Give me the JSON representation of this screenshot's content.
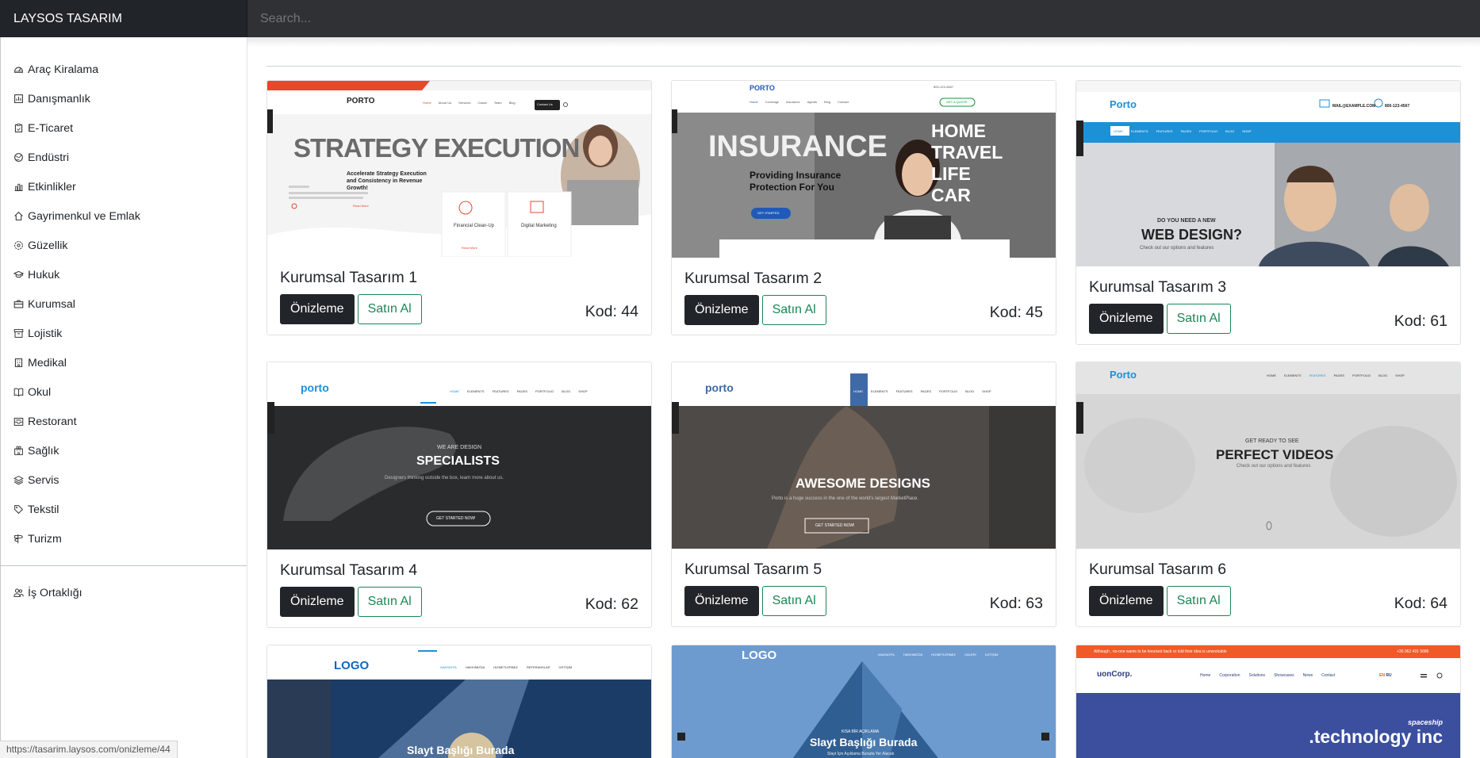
{
  "app": {
    "brand": "LAYSOS TASARIM"
  },
  "search": {
    "placeholder": "Search..."
  },
  "sidebar": {
    "items": [
      {
        "label": "Araç Kiralama",
        "icon": "speedometer-icon"
      },
      {
        "label": "Danışmanlık",
        "icon": "chart-icon"
      },
      {
        "label": "E-Ticaret",
        "icon": "clipboard-icon"
      },
      {
        "label": "Endüstri",
        "icon": "globe-icon"
      },
      {
        "label": "Etkinlikler",
        "icon": "bar-chart-icon"
      },
      {
        "label": "Gayrimenkul ve Emlak",
        "icon": "house-icon"
      },
      {
        "label": "Güzellik",
        "icon": "flower-icon"
      },
      {
        "label": "Hukuk",
        "icon": "mortarboard-icon"
      },
      {
        "label": "Kurumsal",
        "icon": "briefcase-icon"
      },
      {
        "label": "Lojistik",
        "icon": "archive-icon"
      },
      {
        "label": "Medikal",
        "icon": "building-icon"
      },
      {
        "label": "Okul",
        "icon": "book-icon"
      },
      {
        "label": "Restorant",
        "icon": "inbox-icon"
      },
      {
        "label": "Sağlık",
        "icon": "hospital-icon"
      },
      {
        "label": "Servis",
        "icon": "layers-icon"
      },
      {
        "label": "Tekstil",
        "icon": "tag-icon"
      },
      {
        "label": "Turizm",
        "icon": "signpost-icon"
      }
    ],
    "partner": {
      "label": "İş Ortaklığı",
      "icon": "people-icon"
    }
  },
  "cards": [
    {
      "title": "Kurumsal Tasarım 1",
      "kod": "Kod: 44",
      "preview": "Önizleme",
      "buy": "Satın Al",
      "thumb": {
        "brand": "PORTO",
        "nav": [
          "Home",
          "About Us",
          "Services",
          "Cases",
          "Team",
          "Blog"
        ],
        "cta": "Contact Us",
        "headline": "STRATEGY EXECUTION",
        "sub": "Accelerate Strategy Execution and Consistency in Revenue Growth!",
        "box1": "Financial Clean-Up",
        "box2": "Digital Marketing",
        "link": "Read More",
        "boxlink": "Read More"
      }
    },
    {
      "title": "Kurumsal Tasarım 2",
      "kod": "Kod: 45",
      "preview": "Önizleme",
      "buy": "Satın Al",
      "thumb": {
        "brand": "PORTO",
        "phone": "800-123-4567",
        "nav": [
          "Home",
          "Coverage",
          "Insurance",
          "Agents",
          "Blog",
          "Contact"
        ],
        "quote": "GET A QUOTE",
        "big": "INSURANCE",
        "words": [
          "HOME",
          "TRAVEL",
          "LIFE",
          "CAR"
        ],
        "sub1": "Providing Insurance",
        "sub2": "Protection For You",
        "btn": "GET STARTED"
      }
    },
    {
      "title": "Kurumsal Tasarım 3",
      "kod": "Kod: 61",
      "preview": "Önizleme",
      "buy": "Satın Al",
      "thumb": {
        "brand": "Porto",
        "email": "MAIL@EXAMPLE.COM",
        "phone": "800-123-4567",
        "nav": [
          "HOME",
          "ELEMENTS",
          "FEATURES",
          "PAGES",
          "PORTFOLIO",
          "BLOG",
          "SHOP"
        ],
        "pre": "DO YOU NEED A NEW",
        "headline": "WEB DESIGN?",
        "sub": "Check out our options and features"
      }
    },
    {
      "title": "Kurumsal Tasarım 4",
      "kod": "Kod: 62",
      "preview": "Önizleme",
      "buy": "Satın Al",
      "thumb": {
        "brand": "porto",
        "nav": [
          "HOME",
          "ELEMENTS",
          "FEATURES",
          "PAGES",
          "PORTFOLIO",
          "BLOG",
          "SHOP"
        ],
        "pre": "WE ARE DESIGN",
        "headline": "SPECIALISTS",
        "sub": "Designers thinking outside the box, learn more about us.",
        "btn": "GET STARTED NOW!"
      }
    },
    {
      "title": "Kurumsal Tasarım 5",
      "kod": "Kod: 63",
      "preview": "Önizleme",
      "buy": "Satın Al",
      "thumb": {
        "brand": "porto",
        "nav": [
          "HOME",
          "ELEMENTS",
          "FEATURES",
          "PAGES",
          "PORTFOLIO",
          "BLOG",
          "SHOP"
        ],
        "headline": "AWESOME DESIGNS",
        "sub": "Porto is a huge success in the one of the world's largest MarketPlace.",
        "btn": "GET STARTED NOW!"
      }
    },
    {
      "title": "Kurumsal Tasarım 6",
      "kod": "Kod: 64",
      "preview": "Önizleme",
      "buy": "Satın Al",
      "thumb": {
        "brand": "Porto",
        "nav": [
          "HOME",
          "ELEMENTS",
          "FEATURES",
          "PAGES",
          "PORTFOLIO",
          "BLOG",
          "SHOP"
        ],
        "pre": "GET READY TO SEE",
        "headline": "PERFECT VIDEOS",
        "sub": "Check out our options and features"
      }
    },
    {
      "thumb": {
        "brand": "LOGO",
        "nav": [
          "ANASAYFA",
          "HAKKIMIZDA",
          "HIZMETLERIMIZ",
          "REFERANSLAR",
          "İLETİŞİM"
        ],
        "headline": "Slayt Başlığı Burada"
      }
    },
    {
      "thumb": {
        "brand": "LOGO",
        "nav": [
          "ANASAYFA",
          "HAKKIMIZDA",
          "HIZMETLERIMIZ",
          "GALERI",
          "İLETİŞİM"
        ],
        "pre": "KISA BİR AÇIKLAMA",
        "headline": "Slayt Başlığı Burada",
        "sub": "Slayt İçin Açıklama Burada Yer Alacak"
      }
    },
    {
      "thumb": {
        "brand": "uonCorp.",
        "notice": "Although , no-one wants to be knocked back or told their idea is unworkable",
        "phone": "+36 062 431 5686",
        "nav": [
          "Home",
          "Corporation",
          "Solutions",
          "Showcases",
          "News",
          "Contact"
        ],
        "lang": "EN",
        "lang2": "RU",
        "pre": "spaceship",
        "headline": ".technology inc"
      }
    }
  ],
  "status_url": "https://tasarim.laysos.com/onizleme/44"
}
